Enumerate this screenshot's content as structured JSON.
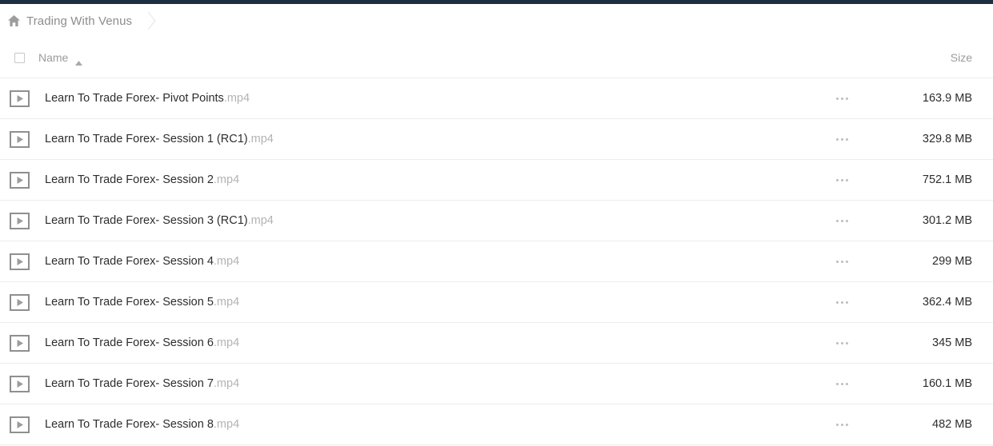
{
  "theme": {
    "accent_bar_color": "#1d2f41",
    "row_border_color": "#ececec",
    "muted_text_color": "#9b9b9b",
    "primary_text_color": "#2d2d2d",
    "extension_text_color": "#b3b3b3"
  },
  "breadcrumb": {
    "home_icon": "home-icon",
    "separator_icon": "chevron-right-icon",
    "items": [
      {
        "label": "Trading With Venus"
      }
    ]
  },
  "table": {
    "columns": {
      "name": "Name",
      "size": "Size"
    },
    "sort": {
      "column": "Name",
      "direction": "asc",
      "icon": "caret-up-icon"
    },
    "select_all_checkbox": {
      "checked": false,
      "icon": "checkbox-icon"
    },
    "row_icon": "video-play-icon",
    "row_menu_icon": "ellipsis-icon",
    "rows": [
      {
        "name": "Learn To Trade Forex- Pivot Points",
        "ext": ".mp4",
        "size": "163.9 MB"
      },
      {
        "name": "Learn To Trade Forex- Session 1 (RC1)",
        "ext": ".mp4",
        "size": "329.8 MB"
      },
      {
        "name": "Learn To Trade Forex- Session 2",
        "ext": ".mp4",
        "size": "752.1 MB"
      },
      {
        "name": "Learn To Trade Forex- Session 3 (RC1)",
        "ext": ".mp4",
        "size": "301.2 MB"
      },
      {
        "name": "Learn To Trade Forex- Session 4",
        "ext": ".mp4",
        "size": "299 MB"
      },
      {
        "name": "Learn To Trade Forex- Session 5",
        "ext": ".mp4",
        "size": "362.4 MB"
      },
      {
        "name": "Learn To Trade Forex- Session 6",
        "ext": ".mp4",
        "size": "345 MB"
      },
      {
        "name": "Learn To Trade Forex- Session 7",
        "ext": ".mp4",
        "size": "160.1 MB"
      },
      {
        "name": "Learn To Trade Forex- Session 8",
        "ext": ".mp4",
        "size": "482 MB"
      }
    ]
  }
}
